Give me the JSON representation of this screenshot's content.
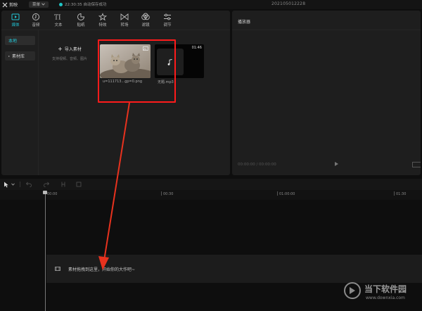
{
  "app": {
    "name": "剪映",
    "menu_label": "菜单",
    "autosave_status": "22:30:35 自动保存成功",
    "project_name": "202105012228"
  },
  "media_toolbar": {
    "items": [
      {
        "label": "媒体",
        "icon": "media-icon",
        "active": true
      },
      {
        "label": "音频",
        "icon": "audio-icon",
        "active": false
      },
      {
        "label": "文本",
        "icon": "text-icon",
        "active": false
      },
      {
        "label": "贴纸",
        "icon": "sticker-icon",
        "active": false
      },
      {
        "label": "特效",
        "icon": "effects-icon",
        "active": false
      },
      {
        "label": "转场",
        "icon": "transition-icon",
        "active": false
      },
      {
        "label": "滤镜",
        "icon": "filter-icon",
        "active": false
      },
      {
        "label": "调节",
        "icon": "adjust-icon",
        "active": false
      }
    ]
  },
  "media_nav": {
    "local_label": "本地",
    "library_label": "素材库"
  },
  "import": {
    "label": "导入素材",
    "hint": "支持视频、音频、图片"
  },
  "media_items": [
    {
      "name": "u=111713...gp=0.png",
      "type": "image"
    },
    {
      "name": "无题.mp3",
      "type": "audio",
      "duration": "01:46"
    }
  ],
  "player": {
    "title": "播放器",
    "timecode": "00:00:00 / 00:00:00"
  },
  "timeline": {
    "ruler_labels": [
      "00:00",
      "00:30",
      "01:00:00",
      "01:30"
    ],
    "drop_hint": "素材拖拽到这里，开始你的大作吧~"
  },
  "watermark": {
    "title": "当下软件园",
    "url": "www.downxia.com"
  },
  "colors": {
    "accent": "#21c6d6",
    "highlight": "#ff1b1b",
    "arrow": "#e8321e"
  }
}
